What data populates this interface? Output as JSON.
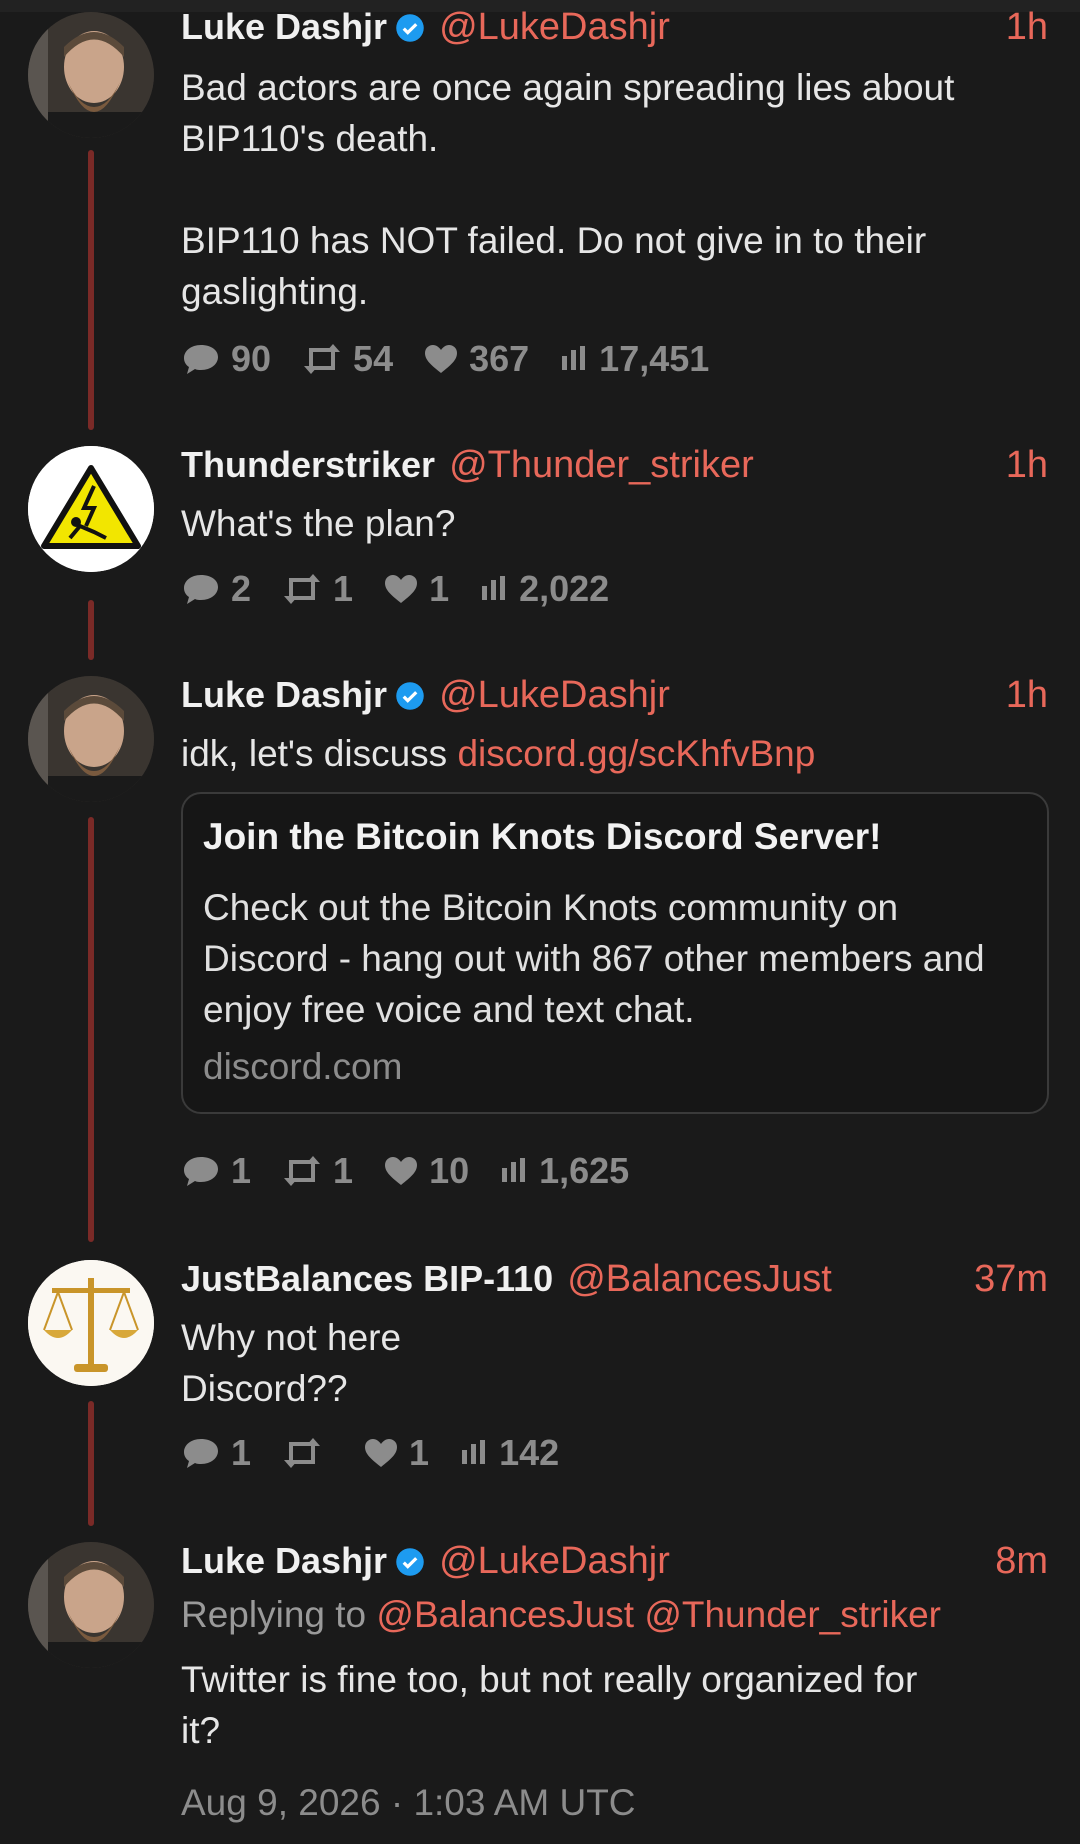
{
  "tweets": [
    {
      "name": "Luke Dashjr",
      "handle": "@LukeDashjr",
      "time": "1h",
      "text_lines": [
        "Bad actors are once again spreading lies about",
        "BIP110's death.",
        "",
        "BIP110 has NOT failed. Do not give in to their",
        "gaslighting."
      ],
      "replies": "90",
      "retweets": "54",
      "likes": "367",
      "views": "17,451"
    },
    {
      "name": "Thunderstriker",
      "handle": "@Thunder_striker",
      "time": "1h",
      "text": "What's the plan?",
      "replies": "2",
      "retweets": "1",
      "likes": "1",
      "views": "2,022"
    },
    {
      "name": "Luke Dashjr",
      "handle": "@LukeDashjr",
      "time": "1h",
      "text_prefix": "idk, let's discuss ",
      "link": "discord.gg/scKhfvBnp",
      "card": {
        "title": "Join the Bitcoin Knots Discord Server!",
        "description_lines": [
          "Check out the Bitcoin Knots community on",
          "Discord - hang out with 867 other members and",
          "enjoy free voice and text chat."
        ],
        "domain": "discord.com"
      },
      "replies": "1",
      "retweets": "1",
      "likes": "10",
      "views": "1,625"
    },
    {
      "name": "JustBalances BIP-110",
      "handle": "@BalancesJust",
      "time": "37m",
      "text_lines": [
        "Why not here",
        "Discord??"
      ],
      "replies": "1",
      "retweets": "",
      "likes": "1",
      "views": "142"
    },
    {
      "name": "Luke Dashjr",
      "handle": "@LukeDashjr",
      "time": "8m",
      "replying_label": "Replying to",
      "replying_to": [
        "@BalancesJust",
        "@Thunder_striker"
      ],
      "text_lines": [
        "Twitter is fine too, but not really organized for",
        "it?"
      ],
      "date": "Aug 9, 2026 · 1:03 AM UTC"
    }
  ],
  "colors": {
    "accent": "#e8685a",
    "thread": "#7a2a27",
    "verified": "#1d9bf0",
    "muted": "#8c8c8c"
  },
  "icons": [
    "verified-icon",
    "comment-icon",
    "retweet-icon",
    "heart-icon",
    "views-icon"
  ]
}
